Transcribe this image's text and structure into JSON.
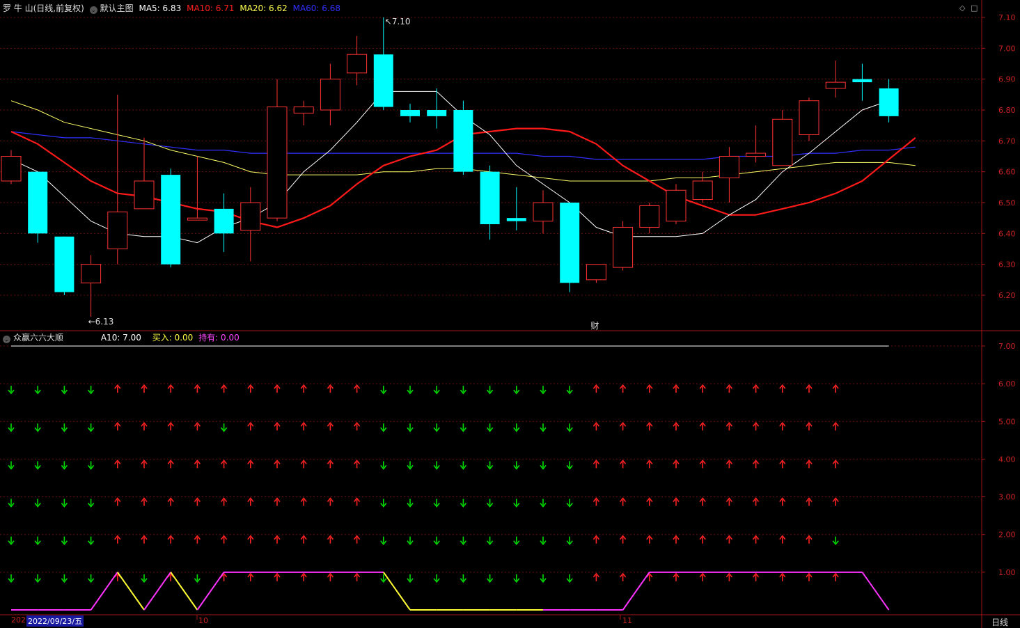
{
  "main_header": {
    "stock": "罗 牛 山(日线,前复权)",
    "template": "默认主图",
    "ma5": "MA5: 6.83",
    "ma10": "MA10: 6.71",
    "ma20": "MA20: 6.62",
    "ma60": "MA60: 6.68"
  },
  "colors": {
    "up": "#ff3333",
    "down": "#00ffff",
    "ma5": "#ffffff",
    "ma10": "#ff1a1a",
    "ma20": "#ffff66",
    "ma60": "#3030ff",
    "arrow_up": "#ff2222",
    "arrow_down": "#00dd00",
    "line_magenta": "#ff33ff",
    "line_yellow": "#ffff33"
  },
  "sub_header": {
    "indicator": "众赢六六大顺",
    "a10": "A10: 7.00",
    "buy": "买入: 0.00",
    "hold": "持有: 0.00"
  },
  "annotations": {
    "high": "7.10",
    "low": "6.13",
    "event": "财"
  },
  "window_controls": {
    "diamond": "◇",
    "square": "□"
  },
  "bottom_axis": {
    "year_stub": "202",
    "cursor_date": "2022/09/23/五",
    "month_oct": "10",
    "month_nov": "11",
    "period": "日线"
  },
  "chart_data": {
    "type": "candlestick",
    "main_yaxis": {
      "ylim": [
        6.1,
        7.13
      ],
      "ticks": [
        "7.10",
        "7.00",
        "6.90",
        "6.80",
        "6.70",
        "6.60",
        "6.50",
        "6.40",
        "6.30",
        "6.20"
      ]
    },
    "candles": [
      {
        "o": 6.57,
        "h": 6.67,
        "l": 6.56,
        "c": 6.65
      },
      {
        "o": 6.6,
        "h": 6.6,
        "l": 6.37,
        "c": 6.4
      },
      {
        "o": 6.39,
        "h": 6.39,
        "l": 6.2,
        "c": 6.21
      },
      {
        "o": 6.24,
        "h": 6.33,
        "l": 6.13,
        "c": 6.3
      },
      {
        "o": 6.35,
        "h": 6.85,
        "l": 6.3,
        "c": 6.47
      },
      {
        "o": 6.48,
        "h": 6.71,
        "l": 6.48,
        "c": 6.57
      },
      {
        "o": 6.59,
        "h": 6.61,
        "l": 6.29,
        "c": 6.3
      },
      {
        "o": 6.45,
        "h": 6.65,
        "l": 6.45,
        "c": 6.45
      },
      {
        "o": 6.48,
        "h": 6.53,
        "l": 6.34,
        "c": 6.4
      },
      {
        "o": 6.41,
        "h": 6.55,
        "l": 6.31,
        "c": 6.5
      },
      {
        "o": 6.45,
        "h": 6.9,
        "l": 6.44,
        "c": 6.81
      },
      {
        "o": 6.79,
        "h": 6.83,
        "l": 6.75,
        "c": 6.81
      },
      {
        "o": 6.8,
        "h": 6.95,
        "l": 6.75,
        "c": 6.9
      },
      {
        "o": 6.92,
        "h": 7.04,
        "l": 6.88,
        "c": 6.98
      },
      {
        "o": 6.98,
        "h": 7.1,
        "l": 6.8,
        "c": 6.81
      },
      {
        "o": 6.8,
        "h": 6.82,
        "l": 6.76,
        "c": 6.78
      },
      {
        "o": 6.8,
        "h": 6.87,
        "l": 6.74,
        "c": 6.78
      },
      {
        "o": 6.8,
        "h": 6.83,
        "l": 6.59,
        "c": 6.6
      },
      {
        "o": 6.6,
        "h": 6.62,
        "l": 6.38,
        "c": 6.43
      },
      {
        "o": 6.45,
        "h": 6.55,
        "l": 6.41,
        "c": 6.44
      },
      {
        "o": 6.44,
        "h": 6.54,
        "l": 6.4,
        "c": 6.5
      },
      {
        "o": 6.5,
        "h": 6.5,
        "l": 6.21,
        "c": 6.24
      },
      {
        "o": 6.25,
        "h": 6.3,
        "l": 6.24,
        "c": 6.3
      },
      {
        "o": 6.29,
        "h": 6.44,
        "l": 6.28,
        "c": 6.42
      },
      {
        "o": 6.42,
        "h": 6.5,
        "l": 6.4,
        "c": 6.49
      },
      {
        "o": 6.44,
        "h": 6.56,
        "l": 6.43,
        "c": 6.54
      },
      {
        "o": 6.51,
        "h": 6.6,
        "l": 6.5,
        "c": 6.57
      },
      {
        "o": 6.58,
        "h": 6.68,
        "l": 6.5,
        "c": 6.65
      },
      {
        "o": 6.65,
        "h": 6.75,
        "l": 6.63,
        "c": 6.66
      },
      {
        "o": 6.62,
        "h": 6.8,
        "l": 6.62,
        "c": 6.77
      },
      {
        "o": 6.72,
        "h": 6.84,
        "l": 6.7,
        "c": 6.83
      },
      {
        "o": 6.87,
        "h": 6.96,
        "l": 6.84,
        "c": 6.89
      },
      {
        "o": 6.9,
        "h": 6.95,
        "l": 6.83,
        "c": 6.89
      },
      {
        "o": 6.87,
        "h": 6.9,
        "l": 6.76,
        "c": 6.78
      }
    ],
    "ma5": [
      6.64,
      6.6,
      6.52,
      6.44,
      6.4,
      6.39,
      6.39,
      6.37,
      6.42,
      6.45,
      6.5,
      6.6,
      6.67,
      6.76,
      6.86,
      6.86,
      6.86,
      6.78,
      6.72,
      6.62,
      6.56,
      6.5,
      6.42,
      6.39,
      6.39,
      6.39,
      6.4,
      6.46,
      6.51,
      6.6,
      6.66,
      6.73,
      6.8,
      6.83
    ],
    "ma10": [
      6.73,
      6.69,
      6.63,
      6.57,
      6.53,
      6.52,
      6.5,
      6.48,
      6.47,
      6.44,
      6.42,
      6.45,
      6.49,
      6.56,
      6.62,
      6.65,
      6.67,
      6.72,
      6.73,
      6.74,
      6.74,
      6.73,
      6.69,
      6.62,
      6.57,
      6.52,
      6.49,
      6.46,
      6.46,
      6.48,
      6.5,
      6.53,
      6.57,
      6.64,
      6.71
    ],
    "ma20": [
      6.83,
      6.8,
      6.76,
      6.74,
      6.72,
      6.7,
      6.67,
      6.65,
      6.63,
      6.6,
      6.59,
      6.59,
      6.59,
      6.59,
      6.6,
      6.6,
      6.61,
      6.61,
      6.6,
      6.59,
      6.58,
      6.57,
      6.57,
      6.57,
      6.57,
      6.58,
      6.58,
      6.59,
      6.6,
      6.61,
      6.62,
      6.63,
      6.63,
      6.63,
      6.62
    ],
    "ma60": [
      6.73,
      6.72,
      6.71,
      6.71,
      6.7,
      6.69,
      6.68,
      6.67,
      6.67,
      6.66,
      6.66,
      6.66,
      6.66,
      6.66,
      6.66,
      6.66,
      6.66,
      6.66,
      6.66,
      6.66,
      6.65,
      6.65,
      6.64,
      6.64,
      6.64,
      6.64,
      6.64,
      6.65,
      6.65,
      6.65,
      6.66,
      6.66,
      6.67,
      6.67,
      6.68
    ],
    "sub_yaxis": {
      "ylim": [
        0,
        7.35
      ],
      "ticks": [
        "7.00",
        "6.00",
        "5.00",
        "4.00",
        "3.00",
        "2.00",
        "1.00"
      ]
    },
    "a10_value": 7.0,
    "arrow_rows": [
      "DDDDUUUUUUUUUUDDDDDDDDUUUUUUUUUU",
      "DDDDUUUUDUUUUUDDDDDDDDUUUUUUUUUU",
      "DDDDUUUUUUUUUUDDDDDDDDUUUUUUUUUU",
      "DDDDUUUUUUUUUUDDDDDDDDUUUUUUUUUU",
      "DDDDUUUUUUUUUUDDDDDDDDUUUUUUUUUD",
      "DDDDUDUDUUUUUUDDDDDDDDUUUUUUUUUU"
    ],
    "buy_hold_line": [
      0,
      0,
      0,
      0,
      1,
      0,
      1,
      0,
      1,
      1,
      1,
      1,
      1,
      1,
      1,
      0,
      0,
      0,
      0,
      0,
      0,
      0,
      0,
      0,
      1,
      1,
      1,
      1,
      1,
      1,
      1,
      1,
      1,
      0
    ]
  }
}
